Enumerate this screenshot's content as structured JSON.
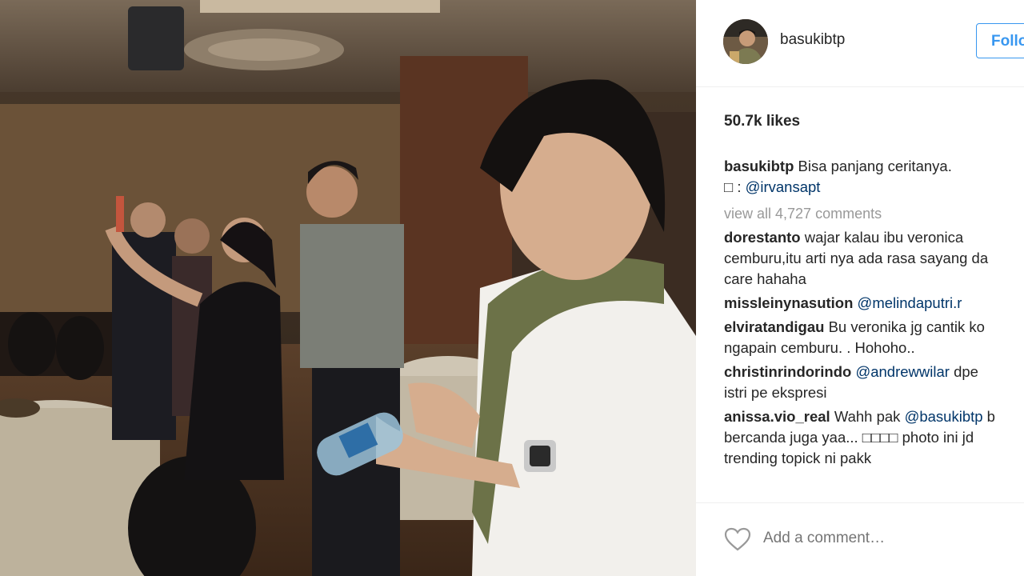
{
  "post": {
    "username": "basukibtp",
    "follow_label": "Follow",
    "likes": "50.7k likes",
    "caption": {
      "username": "basukibtp",
      "text": "Bisa panjang ceritanya.",
      "prefix": "□ : ",
      "mention": "@irvansapt"
    },
    "view_all": "view all 4,727 comments",
    "comments": [
      {
        "user": "dorestanto",
        "line1": "wajar kalau ibu veronica",
        "line2": "cemburu,itu arti nya ada rasa sayang da",
        "line3": "care hahaha"
      },
      {
        "user": "missleinynasution",
        "mention": "@melindaputri.r"
      },
      {
        "user": "elviratandigau",
        "line1": "Bu veronika jg cantik ko",
        "line2": "ngapain cemburu. . Hohoho.."
      },
      {
        "user": "christinrindorindo",
        "mention": "@andrewwilar",
        "after": " dpe",
        "line2": "istri pe ekspresi"
      },
      {
        "user": "anissa.vio_real",
        "line1": "Wahh pak ",
        "mention": "@basukibtp",
        "after": " b",
        "line2": "bercanda juga yaa... □□□□ photo ini jd",
        "line3": "trending topick ni pakk"
      }
    ],
    "add_comment_placeholder": "Add a comment…"
  },
  "colors": {
    "link": "#003569",
    "follow": "#3897f0",
    "muted": "#999999"
  },
  "icons": {
    "like": "heart-icon"
  }
}
